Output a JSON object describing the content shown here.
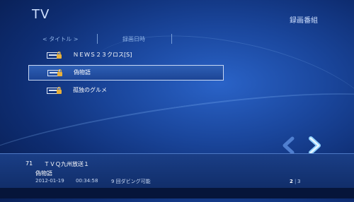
{
  "header": {
    "app_title": "TV",
    "section_title": "録画番組"
  },
  "tabs": [
    {
      "label": "< タイトル >",
      "active": true
    },
    {
      "label": "録画日時",
      "active": false
    }
  ],
  "recordings": [
    {
      "title": "ＮＥＷＳ２３クロス[S]",
      "selected": false
    },
    {
      "title": "偽物語",
      "selected": true
    },
    {
      "title": "孤独のグルメ",
      "selected": false
    }
  ],
  "details": {
    "channel_number": "71",
    "channel_name": "ＴＶＱ九州放送１",
    "program_title": "偽物語",
    "date": "2012-01-19",
    "duration": "00:34:58",
    "dubbing_info": "9 回ダビング可能",
    "page_current": "2",
    "page_total": "3"
  },
  "colors": {
    "accent": "#8fb3e6",
    "lock": "#e8b03a",
    "background": "#1a469c"
  },
  "icons": {
    "nav_prev": "chevron-left-icon",
    "nav_next": "chevron-right-icon",
    "row_icon": "recording-icon",
    "lock": "lock-icon"
  }
}
